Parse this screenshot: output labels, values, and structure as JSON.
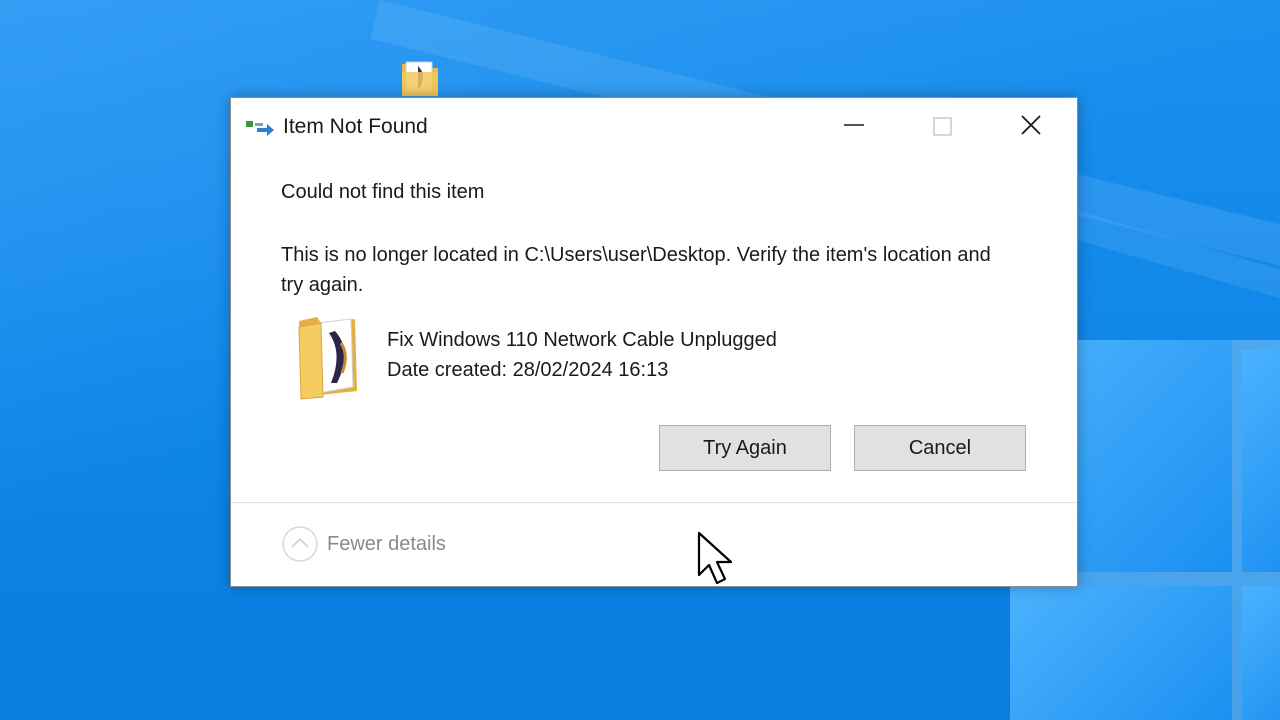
{
  "dialog": {
    "title": "Item Not Found",
    "main_instruction": "Could not find this item",
    "message": "This is no longer located in C:\\Users\\user\\Desktop. Verify the item's location and try again.",
    "item": {
      "name": "Fix Windows 110 Network Cable Unplugged",
      "date_created": "Date created: 28/02/2024 16:13"
    },
    "buttons": {
      "try_again": "Try Again",
      "cancel": "Cancel"
    },
    "details_toggle": "Fewer details",
    "icons": {
      "title": "network-transfer-icon",
      "item": "folder-icon",
      "details": "chevron-up-circle-icon"
    }
  },
  "colors": {
    "desktop_background": "#0f86e8",
    "button_face": "#e1e1e1",
    "muted_text": "#8a8a8a"
  }
}
